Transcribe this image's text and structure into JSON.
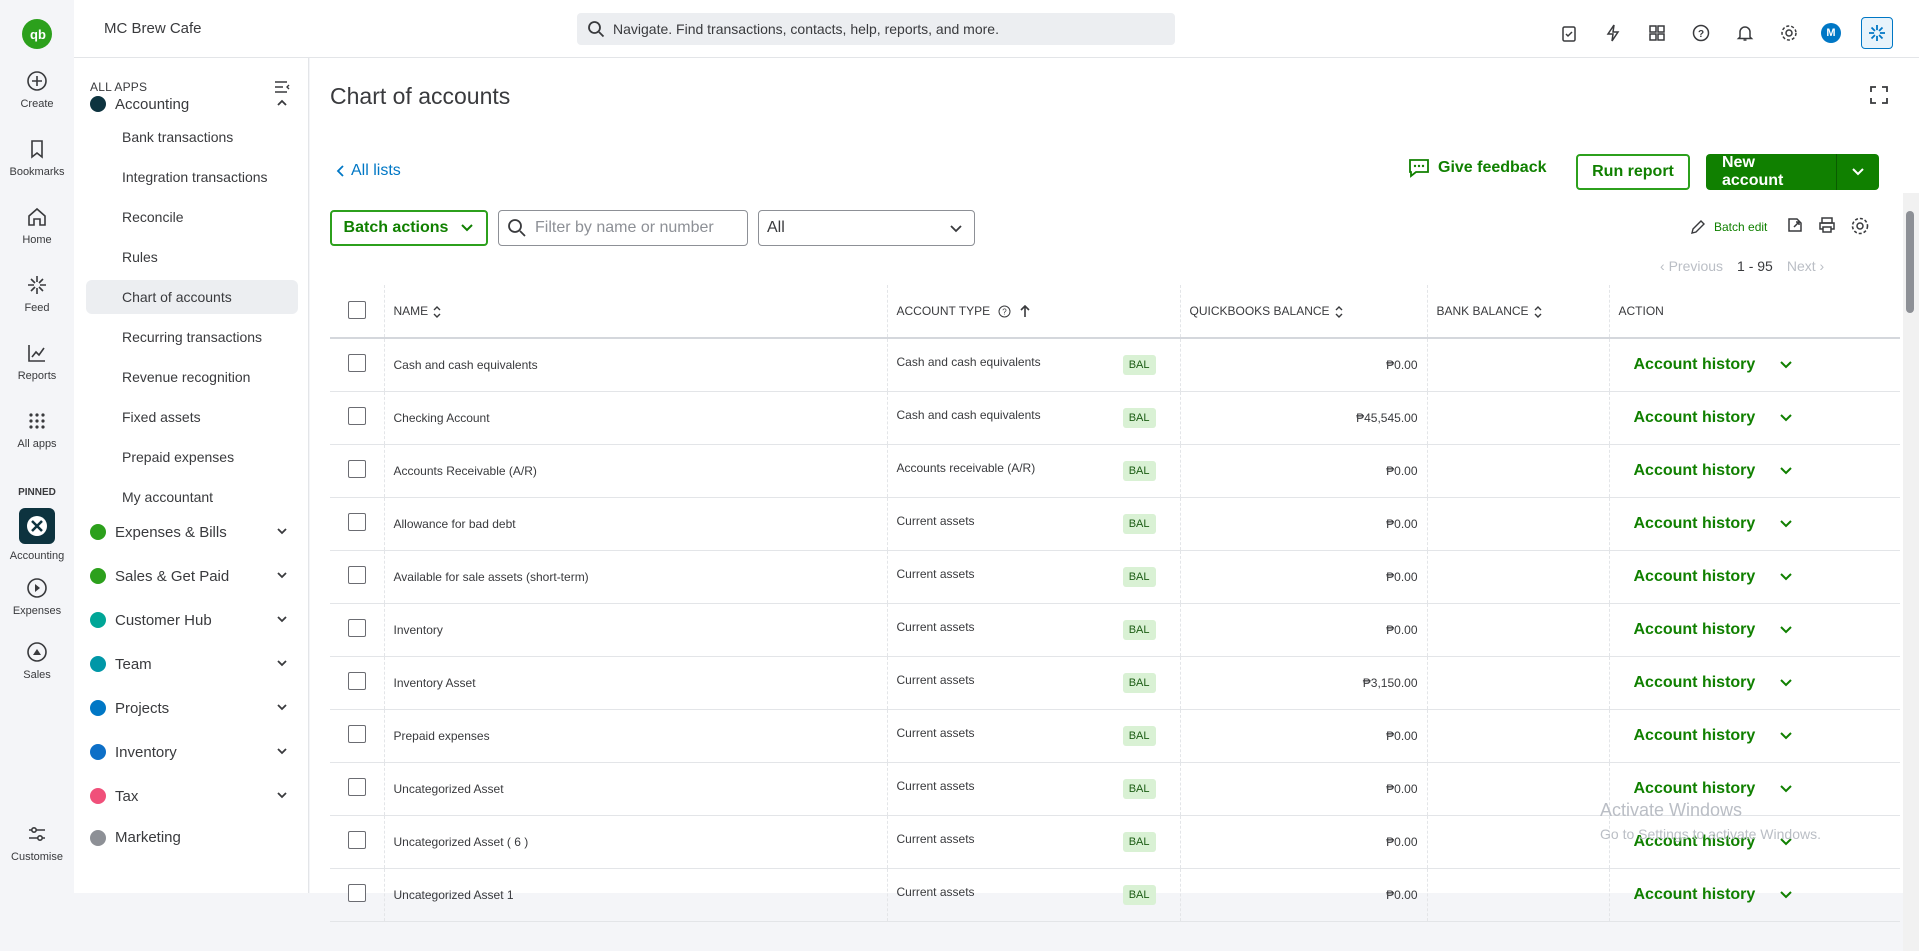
{
  "rail": {
    "items": [
      {
        "label": "Create",
        "icon": "plus-circle-icon"
      },
      {
        "label": "Bookmarks",
        "icon": "bookmark-icon"
      },
      {
        "label": "Home",
        "icon": "home-icon"
      },
      {
        "label": "Feed",
        "icon": "feed-icon"
      },
      {
        "label": "Reports",
        "icon": "reports-icon"
      },
      {
        "label": "All apps",
        "icon": "grid-icon"
      }
    ],
    "pinned_label": "PINNED",
    "pinned": [
      {
        "label": "Accounting",
        "icon": "accounting-icon"
      },
      {
        "label": "Expenses",
        "icon": "expenses-icon"
      },
      {
        "label": "Sales",
        "icon": "sales-icon"
      }
    ],
    "customise": "Customise"
  },
  "topbar": {
    "company": "MC Brew Cafe",
    "search_placeholder": "Navigate. Find transactions, contacts, help, reports, and more.",
    "avatar": "M"
  },
  "nav": {
    "all_apps": "ALL APPS",
    "accounting": "Accounting",
    "sub_items": [
      "Bank transactions",
      "Integration transactions",
      "Reconcile",
      "Rules",
      "Chart of accounts",
      "Recurring transactions",
      "Revenue recognition",
      "Fixed assets",
      "Prepaid expenses",
      "My accountant"
    ],
    "groups": [
      "Expenses & Bills",
      "Sales & Get Paid",
      "Customer Hub",
      "Team",
      "Projects",
      "Inventory",
      "Tax",
      "Marketing"
    ]
  },
  "main": {
    "title": "Chart of accounts",
    "all_lists": "All lists",
    "give_feedback": "Give feedback",
    "run_report": "Run report",
    "new_account": "New account",
    "batch_actions": "Batch actions",
    "filter_placeholder": "Filter by name or number",
    "select_value": "All",
    "batch_edit": "Batch edit",
    "pager": {
      "previous": "Previous",
      "range": "1 - 95",
      "next": "Next"
    },
    "columns": {
      "name": "NAME",
      "account_type": "ACCOUNT TYPE",
      "qb_balance": "QUICKBOOKS BALANCE",
      "bank_balance": "BANK BALANCE",
      "action": "ACTION"
    },
    "rows": [
      {
        "name": "Cash and cash equivalents",
        "type": "Cash and cash equivalents",
        "badge": "BAL",
        "qb": "₱0.00",
        "bank": "",
        "action": "Account history"
      },
      {
        "name": "Checking Account",
        "type": "Cash and cash equivalents",
        "badge": "BAL",
        "qb": "₱45,545.00",
        "bank": "",
        "action": "Account history"
      },
      {
        "name": "Accounts Receivable (A/R)",
        "type": "Accounts receivable (A/R)",
        "badge": "BAL",
        "qb": "₱0.00",
        "bank": "",
        "action": "Account history"
      },
      {
        "name": "Allowance for bad debt",
        "type": "Current assets",
        "badge": "BAL",
        "qb": "₱0.00",
        "bank": "",
        "action": "Account history"
      },
      {
        "name": "Available for sale assets (short-term)",
        "type": "Current assets",
        "badge": "BAL",
        "qb": "₱0.00",
        "bank": "",
        "action": "Account history"
      },
      {
        "name": "Inventory",
        "type": "Current assets",
        "badge": "BAL",
        "qb": "₱0.00",
        "bank": "",
        "action": "Account history"
      },
      {
        "name": "Inventory Asset",
        "type": "Current assets",
        "badge": "BAL",
        "qb": "₱3,150.00",
        "bank": "",
        "action": "Account history"
      },
      {
        "name": "Prepaid expenses",
        "type": "Current assets",
        "badge": "BAL",
        "qb": "₱0.00",
        "bank": "",
        "action": "Account history"
      },
      {
        "name": "Uncategorized Asset",
        "type": "Current assets",
        "badge": "BAL",
        "qb": "₱0.00",
        "bank": "",
        "action": "Account history"
      },
      {
        "name": "Uncategorized Asset ( 6 )",
        "type": "Current assets",
        "badge": "BAL",
        "qb": "₱0.00",
        "bank": "",
        "action": "Account history"
      },
      {
        "name": "Uncategorized Asset 1",
        "type": "Current assets",
        "badge": "BAL",
        "qb": "₱0.00",
        "bank": "",
        "action": "Account history"
      }
    ]
  },
  "watermark": {
    "title": "Activate Windows",
    "subtitle": "Go to Settings to activate Windows."
  },
  "colors": {
    "brand_green": "#2ca01c",
    "action_green": "#108000",
    "link_blue": "#0077c5"
  }
}
